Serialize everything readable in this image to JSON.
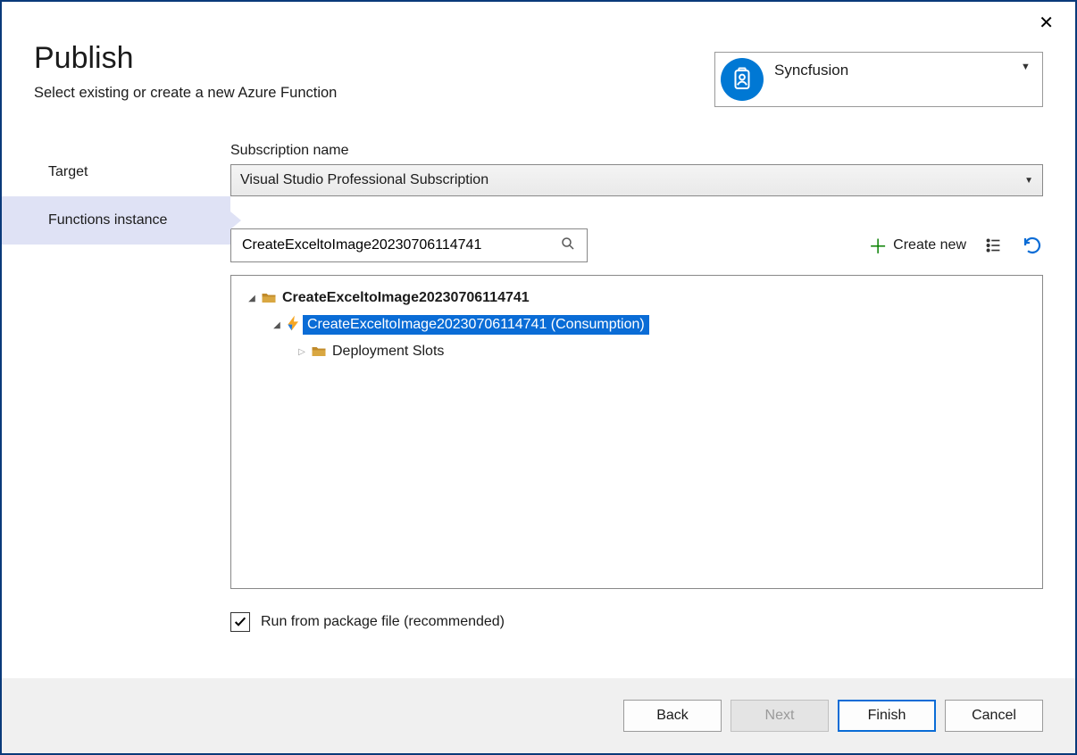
{
  "window": {
    "close": "✕"
  },
  "header": {
    "title": "Publish",
    "subtitle": "Select existing or create a new Azure Function"
  },
  "account": {
    "name": "Syncfusion"
  },
  "sidebar": {
    "items": [
      {
        "label": "Target"
      },
      {
        "label": "Functions instance"
      }
    ],
    "active_index": 1
  },
  "subscription": {
    "label": "Subscription name",
    "value": "Visual Studio Professional Subscription"
  },
  "search": {
    "value": "CreateExceltoImage20230706114741"
  },
  "actions": {
    "create_new": "Create new"
  },
  "tree": {
    "root": {
      "label": "CreateExceltoImage20230706114741"
    },
    "app": {
      "label": "CreateExceltoImage20230706114741 (Consumption)"
    },
    "slots": {
      "label": "Deployment Slots"
    }
  },
  "checkbox": {
    "label": "Run from package file (recommended)",
    "checked": true
  },
  "footer": {
    "back": "Back",
    "next": "Next",
    "finish": "Finish",
    "cancel": "Cancel"
  }
}
